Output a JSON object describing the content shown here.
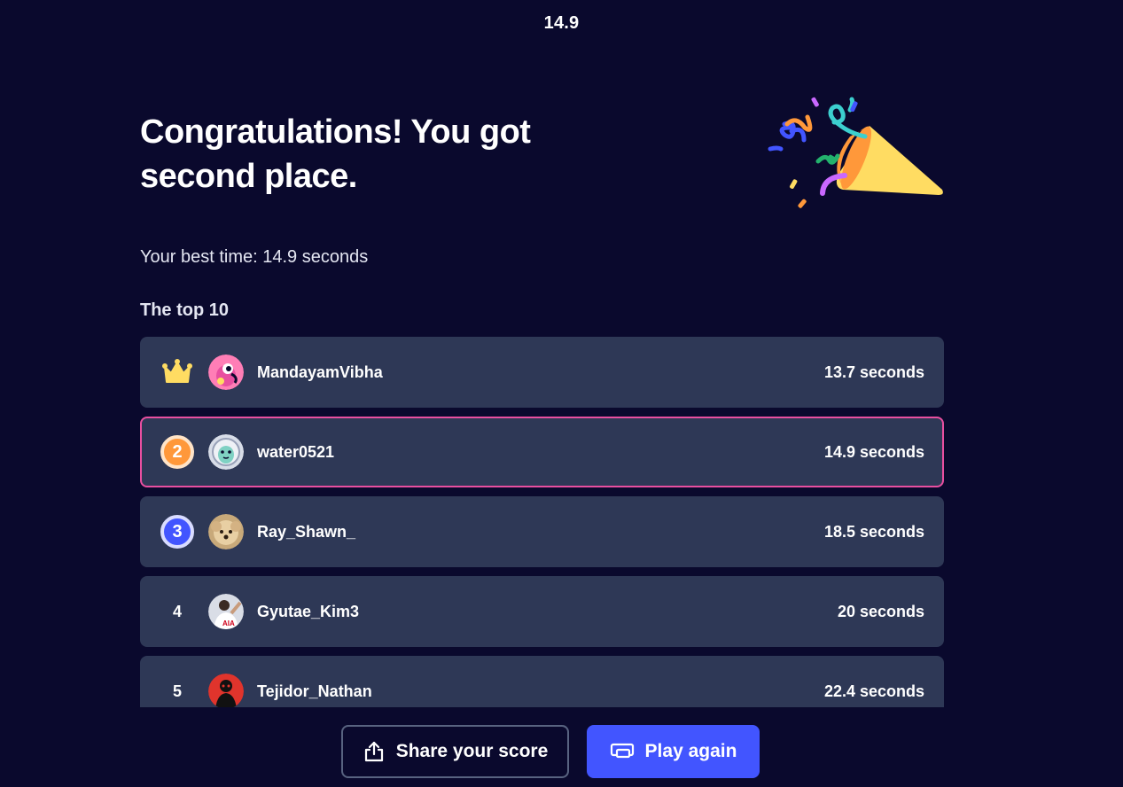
{
  "timer": "14.9",
  "headline": "Congratulations! You got second place.",
  "best_time_text": "Your best time: 14.9 seconds",
  "top_heading": "The top 10",
  "leaderboard": [
    {
      "rank": "1",
      "name": "MandayamVibha",
      "score": "13.7 seconds",
      "rank_icon": "crown-icon"
    },
    {
      "rank": "2",
      "name": "water0521",
      "score": "14.9 seconds",
      "rank_icon": "silver-medal"
    },
    {
      "rank": "3",
      "name": "Ray_Shawn_",
      "score": "18.5 seconds",
      "rank_icon": "bronze-medal"
    },
    {
      "rank": "4",
      "name": "Gyutae_Kim3",
      "score": "20 seconds"
    },
    {
      "rank": "5",
      "name": "Tejidor_Nathan",
      "score": "22.4 seconds"
    }
  ],
  "buttons": {
    "share_label": "Share your score",
    "play_label": "Play again"
  },
  "colors": {
    "background": "#0a092d",
    "row": "#2e3856",
    "highlight_border": "#e84fa0",
    "primary": "#4255ff",
    "medal_2": "#ff983a",
    "medal_3": "#4255ff",
    "crown": "#ffdc62"
  }
}
